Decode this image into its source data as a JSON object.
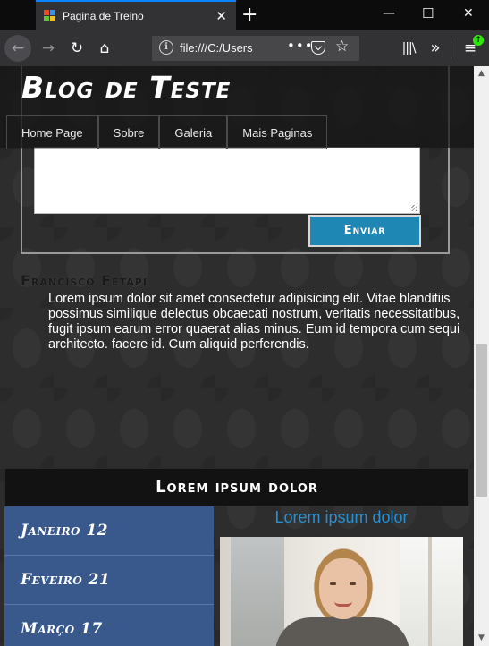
{
  "browser": {
    "tab_title": "Pagina de Treino",
    "url": "file:///C:/Users",
    "icons": {
      "back": "back-arrow-icon",
      "forward": "forward-arrow-icon",
      "reload": "reload-icon",
      "home": "home-icon",
      "page_info": "info-icon",
      "page_actions": "more-dots-icon",
      "pocket": "pocket-icon",
      "bookmark": "star-icon",
      "library": "library-icon",
      "overflow": "chevron-double-right-icon",
      "menu": "hamburger-menu-icon"
    }
  },
  "site": {
    "title": "Blog de Teste",
    "nav": [
      "Home Page",
      "Sobre",
      "Galeria",
      "Mais Paginas"
    ]
  },
  "form": {
    "send_label": "Enviar",
    "textarea_value": ""
  },
  "comment": {
    "author": "Francisco Fetapi",
    "text": "Lorem ipsum dolor sit amet consectetur adipisicing elit. Vitae blanditiis possimus similique delectus obcaecati nostrum, veritatis necessitatibus, fugit ipsum earum error quaerat alias minus. Eum id tempora cum sequi architecto. facere id. Cum aliquid perferendis."
  },
  "section": {
    "title": "Lorem ipsum dolor"
  },
  "archive": {
    "items": [
      "Janeiro 12",
      "Feveiro 21",
      "Março 17"
    ]
  },
  "featured": {
    "title": "Lorem ipsum dolor"
  },
  "colors": {
    "accent_button": "#1f87b3",
    "archive_bg": "#39588c",
    "featured_title": "#2a8fd0",
    "tab_highlight": "#0a84ff"
  }
}
